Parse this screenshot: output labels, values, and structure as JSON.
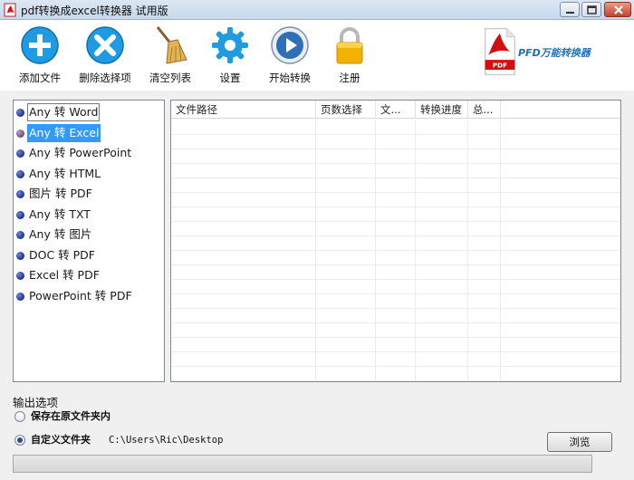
{
  "window": {
    "title": "pdf转换成excel转换器 试用版",
    "controls": [
      "minimize-icon",
      "maximize-icon",
      "close-icon"
    ]
  },
  "toolbar": {
    "items": [
      {
        "label": "添加文件",
        "icon": "add-icon",
        "color": "#1e9be3"
      },
      {
        "label": "删除选择项",
        "icon": "delete-icon",
        "color": "#1e9be3"
      },
      {
        "label": "清空列表",
        "icon": "broom-icon",
        "color": "#d9a441"
      },
      {
        "label": "设置",
        "icon": "gear-icon",
        "color": "#1e9be3"
      },
      {
        "label": "开始转换",
        "icon": "play-icon",
        "color": "#2f6fb5"
      },
      {
        "label": "注册",
        "icon": "lock-icon",
        "color": "#e8a400"
      }
    ]
  },
  "brand": {
    "label": "PFD万能转换器",
    "icon": "pdf-logo-icon",
    "color": "#1f6fb5"
  },
  "conversion_list": {
    "items": [
      {
        "label": "Any 转 Word",
        "state": "focused"
      },
      {
        "label": "Any 转 Excel",
        "state": "selected"
      },
      {
        "label": "Any 转 PowerPoint",
        "state": "normal"
      },
      {
        "label": "Any 转 HTML",
        "state": "normal"
      },
      {
        "label": "图片 转 PDF",
        "state": "normal"
      },
      {
        "label": "Any 转 TXT",
        "state": "normal"
      },
      {
        "label": "Any 转 图片",
        "state": "normal"
      },
      {
        "label": "DOC 转 PDF",
        "state": "normal"
      },
      {
        "label": "Excel 转 PDF",
        "state": "normal"
      },
      {
        "label": "PowerPoint 转 PDF",
        "state": "normal"
      }
    ],
    "selected_color": "#3399ff"
  },
  "file_grid": {
    "columns": [
      "文件路径",
      "页数选择",
      "文...",
      "转换进度",
      "总..."
    ],
    "rows": []
  },
  "output": {
    "title": "输出选项",
    "options": [
      {
        "label": "保存在原文件夹内",
        "checked": false
      },
      {
        "label": "自定义文件夹",
        "checked": true
      }
    ],
    "custom_path": "C:\\Users\\Ric\\Desktop",
    "browse_label": "浏览"
  },
  "progress": {
    "fraction": 0.0,
    "color": "#38b44a"
  }
}
